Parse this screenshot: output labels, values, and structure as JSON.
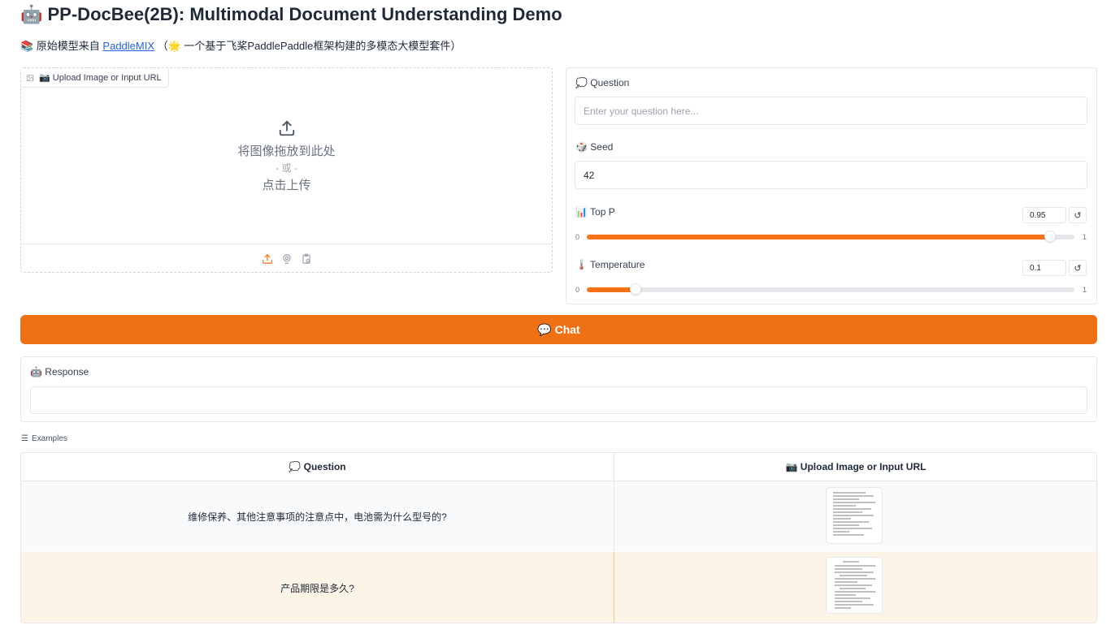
{
  "header": {
    "title": "🤖 PP-DocBee(2B): Multimodal Document Understanding Demo",
    "subtitle_prefix": "📚 原始模型来自 ",
    "subtitle_link": "PaddleMIX",
    "subtitle_suffix": " （🌟 一个基于飞桨PaddlePaddle框架构建的多模态大模型套件）"
  },
  "upload": {
    "label": "📷 Upload Image or Input URL",
    "drop_text": "将图像拖放到此处",
    "or_text": "- 或 -",
    "click_text": "点击上传"
  },
  "question": {
    "label": "💭 Question",
    "placeholder": "Enter your question here...",
    "value": ""
  },
  "seed": {
    "label": "🎲 Seed",
    "value": "42"
  },
  "top_p": {
    "label": "📊 Top P",
    "value": "0.95",
    "min": "0",
    "max": "1",
    "fraction": 0.95
  },
  "temperature": {
    "label": "🌡️ Temperature",
    "value": "0.1",
    "min": "0",
    "max": "1",
    "fraction": 0.1
  },
  "chat_button": {
    "label": "💬 Chat"
  },
  "response": {
    "label": "🤖 Response",
    "value": ""
  },
  "examples": {
    "label": "Examples",
    "headers": [
      "💭 Question",
      "📷 Upload Image or Input URL"
    ],
    "rows": [
      {
        "question": "维修保养、其他注意事项的注意点中，电池需为什么型号的?"
      },
      {
        "question": "产品期限是多久?"
      }
    ]
  },
  "colors": {
    "accent": "#f07014",
    "slider_fill": "#f97316",
    "link": "#2563eb",
    "row_alt": "#f9fafb",
    "row_hover": "#fdf4e8"
  }
}
